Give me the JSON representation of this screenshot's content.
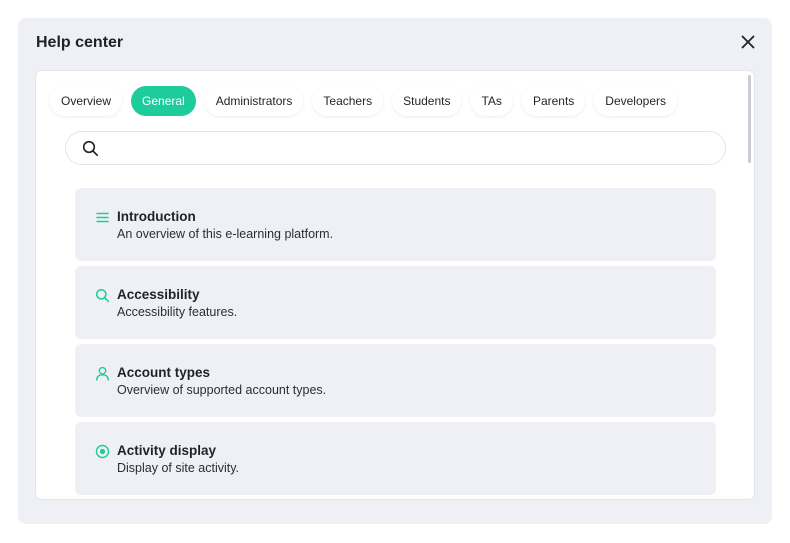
{
  "dialog": {
    "title": "Help center"
  },
  "tabs": [
    {
      "label": "Overview",
      "active": false
    },
    {
      "label": "General",
      "active": true
    },
    {
      "label": "Administrators",
      "active": false
    },
    {
      "label": "Teachers",
      "active": false
    },
    {
      "label": "Students",
      "active": false
    },
    {
      "label": "TAs",
      "active": false
    },
    {
      "label": "Parents",
      "active": false
    },
    {
      "label": "Developers",
      "active": false
    }
  ],
  "search": {
    "value": "",
    "placeholder": ""
  },
  "articles": [
    {
      "icon": "list-icon",
      "title": "Introduction",
      "description": "An overview of this e-learning platform."
    },
    {
      "icon": "search-icon",
      "title": "Accessibility",
      "description": "Accessibility features."
    },
    {
      "icon": "user-icon",
      "title": "Account types",
      "description": "Overview of supported account types."
    },
    {
      "icon": "radio-dot-icon",
      "title": "Activity display",
      "description": "Display of site activity."
    }
  ],
  "colors": {
    "accent": "#1ecb9b",
    "dialog_bg": "#eff0f5",
    "card_bg": "#eff0f5"
  }
}
